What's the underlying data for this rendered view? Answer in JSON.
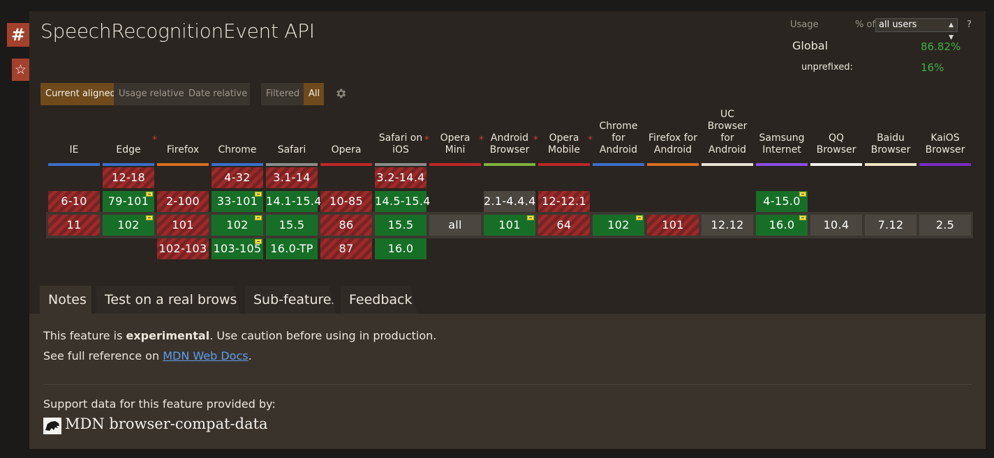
{
  "sidebar": {
    "hash_icon": "#",
    "star_icon": "☆"
  },
  "title": "SpeechRecognitionEvent API",
  "usage": {
    "label": "Usage",
    "percent_of": "% of",
    "select_value": "all users",
    "help": "?",
    "global_label": "Global",
    "global_value": "86.82%",
    "unprefixed_label": "unprefixed:",
    "unprefixed_value": "16%"
  },
  "view_buttons": [
    "Current aligned",
    "Usage relative",
    "Date relative"
  ],
  "filter_buttons": [
    "Filtered",
    "All"
  ],
  "browsers": [
    {
      "name": "IE",
      "asterisk": false,
      "color": "#3b6ecc",
      "cells": [
        "",
        "6-10",
        "11",
        ""
      ]
    },
    {
      "name": "Edge",
      "asterisk": true,
      "color": "#3b6ecc",
      "cells": [
        "12-18",
        "79-101",
        "102",
        ""
      ]
    },
    {
      "name": "Firefox",
      "asterisk": false,
      "color": "#d66f21",
      "cells": [
        "",
        "2-100",
        "101",
        "102-103"
      ]
    },
    {
      "name": "Chrome",
      "asterisk": false,
      "color": "#3b6ecc",
      "cells": [
        "4-32",
        "33-101",
        "102",
        "103-105"
      ]
    },
    {
      "name": "Safari",
      "asterisk": false,
      "color": "#8c8c8c",
      "cells": [
        "3.1-14",
        "14.1-15.4",
        "15.5",
        "16.0-TP"
      ]
    },
    {
      "name": "Opera",
      "asterisk": false,
      "color": "#c02727",
      "cells": [
        "",
        "10-85",
        "86",
        "87"
      ]
    },
    {
      "name": "Safari on iOS",
      "asterisk": true,
      "color": "#8c8c8c",
      "cells": [
        "3.2-14.4",
        "14.5-15.4",
        "15.5",
        "16.0"
      ]
    },
    {
      "name": "Opera Mini",
      "asterisk": true,
      "color": "#c02727",
      "cells": [
        "",
        "",
        "all",
        ""
      ]
    },
    {
      "name": "Android Browser",
      "asterisk": true,
      "color": "#7fb33a",
      "cells": [
        "",
        "2.1-4.4.4",
        "101",
        ""
      ]
    },
    {
      "name": "Opera Mobile",
      "asterisk": true,
      "color": "#c02727",
      "cells": [
        "",
        "12-12.1",
        "64",
        ""
      ]
    },
    {
      "name": "Chrome for Android",
      "asterisk": false,
      "color": "#3b6ecc",
      "cells": [
        "",
        "",
        "102",
        ""
      ]
    },
    {
      "name": "Firefox for Android",
      "asterisk": false,
      "color": "#d66f21",
      "cells": [
        "",
        "",
        "101",
        ""
      ]
    },
    {
      "name": "UC Browser for Android",
      "asterisk": false,
      "color": "#e8e2d8",
      "cells": [
        "",
        "",
        "12.12",
        ""
      ]
    },
    {
      "name": "Samsung Internet",
      "asterisk": false,
      "color": "#8a4ee6",
      "cells": [
        "",
        "4-15.0",
        "16.0",
        ""
      ]
    },
    {
      "name": "QQ Browser",
      "asterisk": false,
      "color": "#f4f1ec",
      "cells": [
        "",
        "",
        "10.4",
        ""
      ]
    },
    {
      "name": "Baidu Browser",
      "asterisk": false,
      "color": "#efe6c4",
      "cells": [
        "",
        "",
        "7.12",
        ""
      ]
    },
    {
      "name": "KaiOS Browser",
      "asterisk": false,
      "color": "#7a2cc6",
      "cells": [
        "",
        "",
        "2.5",
        ""
      ]
    }
  ],
  "tabs": [
    "Notes",
    "Test on a real browser",
    "Sub-features",
    "Feedback"
  ],
  "notes": {
    "line1_pre": "This feature is ",
    "line1_bold": "experimental",
    "line1_post": ". Use caution before using in production.",
    "line2_pre": "See full reference on ",
    "line2_link": "MDN Web Docs",
    "line2_post": "."
  },
  "support": {
    "text": "Support data for this feature provided by:",
    "source": "MDN browser-compat-data"
  },
  "colors": {
    "supported": "#176f27",
    "unsupported": "#9b2b2b",
    "unknown": "#4b4640",
    "accent": "#a3412d",
    "active_toggle": "#6e4a1c"
  }
}
